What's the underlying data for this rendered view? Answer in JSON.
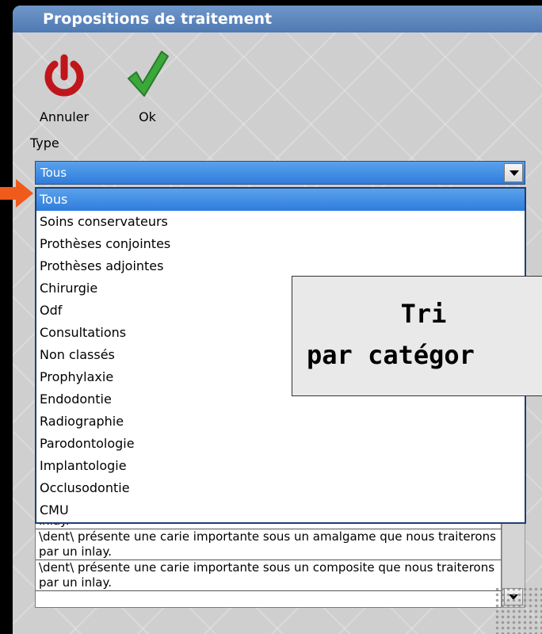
{
  "window": {
    "title": "Propositions de traitement"
  },
  "toolbar": {
    "cancel_label": "Annuler",
    "cancel_icon": "power-icon",
    "ok_label": "Ok",
    "ok_icon": "checkmark-icon"
  },
  "type_field": {
    "label": "Type",
    "selected_value": "Tous",
    "options": [
      "Tous",
      "Soins conservateurs",
      "Prothèses conjointes",
      "Prothèses adjointes",
      "Chirurgie",
      "Odf",
      "Consultations",
      "Non classés",
      "Prophylaxie",
      "Endodontie",
      "Radiographie",
      "Parodontologie",
      "Implantologie",
      "Occlusodontie",
      "CMU"
    ]
  },
  "callout": {
    "line1": "Tri",
    "line2": "par catégor"
  },
  "background_list": {
    "items": [
      "inlay.",
      "\\dent\\ présente une carie importante sous un amalgame que nous traiterons par un inlay.",
      "\\dent\\ présente une carie importante sous un composite que nous traiterons par un inlay."
    ]
  },
  "colors": {
    "title_bar": "#5a84bd",
    "selection": "#3d8ae3",
    "pointer_arrow": "#f05a1a",
    "power_icon": "#c0151b",
    "check_icon": "#3aa83a"
  }
}
